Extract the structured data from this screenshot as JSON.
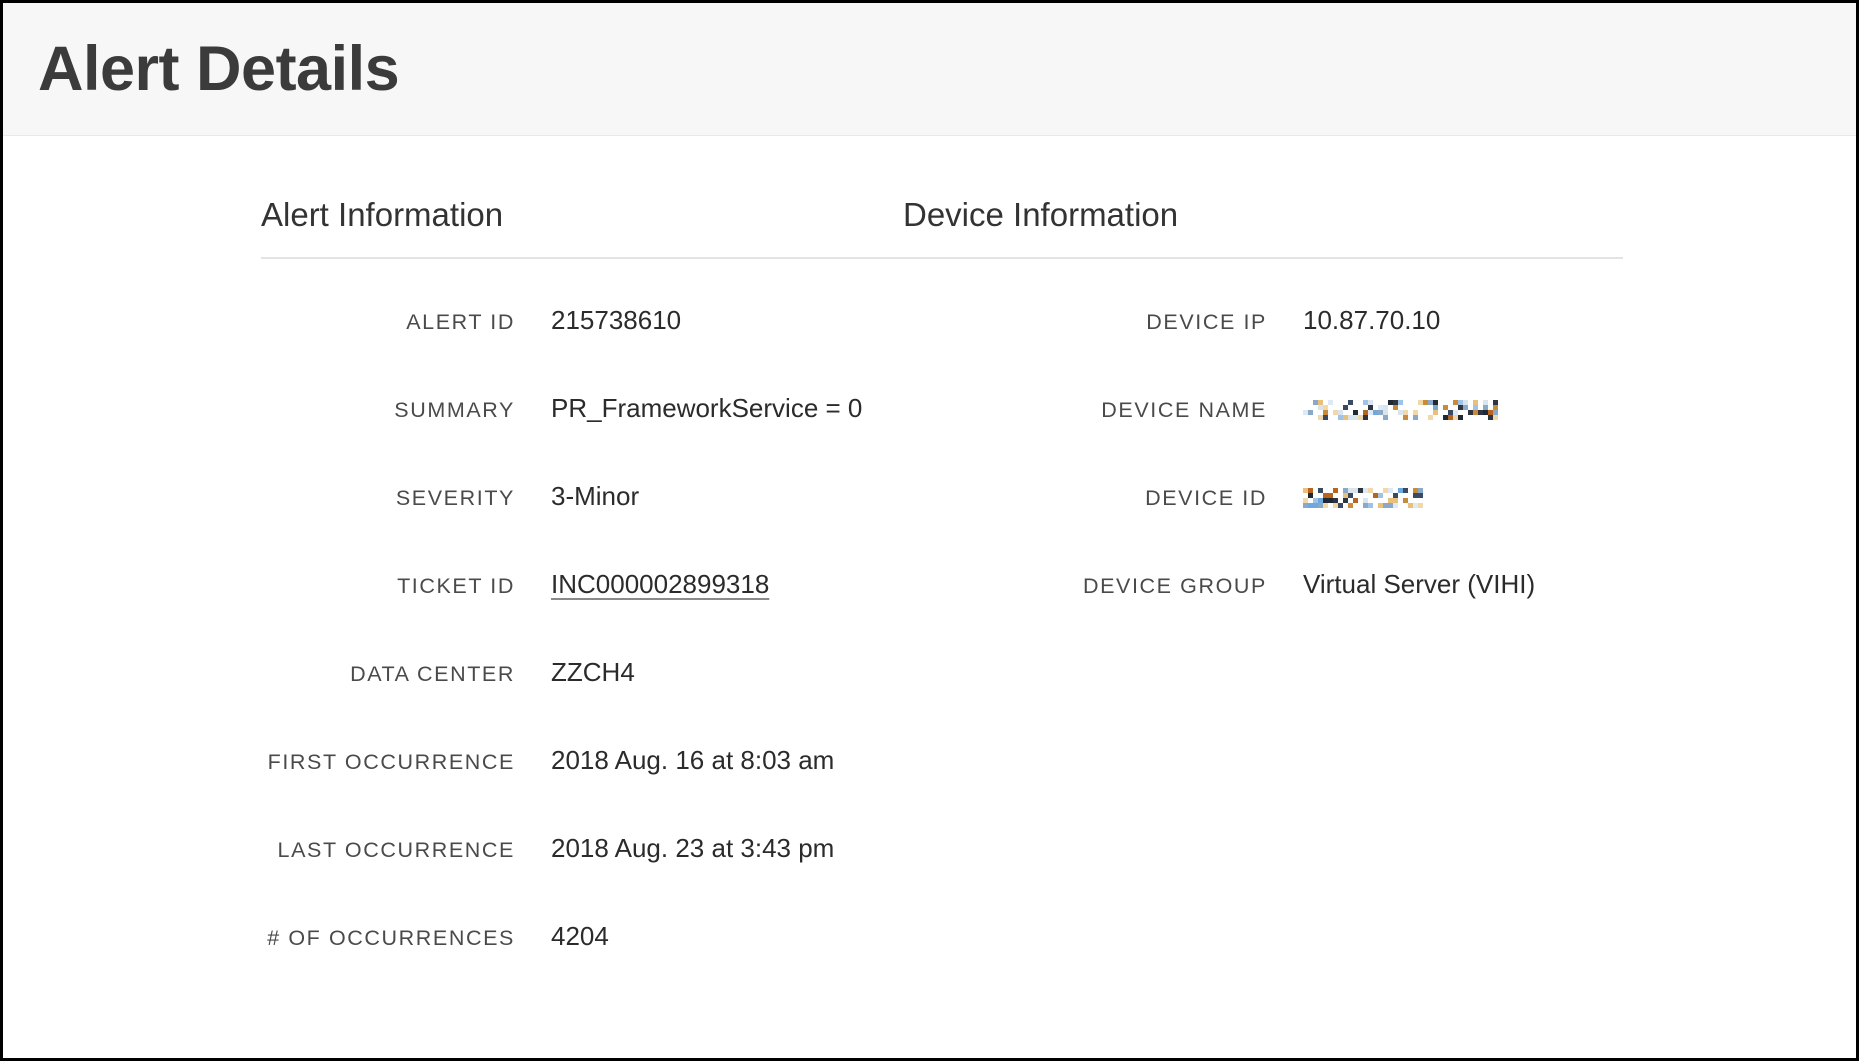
{
  "header": {
    "title": "Alert Details",
    "background_color": "#f7f7f7",
    "title_color": "#3b3b3b"
  },
  "alert_information": {
    "heading": "Alert Information",
    "fields": [
      {
        "label": "ALERT ID",
        "value": "215738610",
        "type": "text"
      },
      {
        "label": "SUMMARY",
        "value": "PR_FrameworkService = 0",
        "type": "text"
      },
      {
        "label": "SEVERITY",
        "value": "3-Minor",
        "type": "text"
      },
      {
        "label": "TICKET ID",
        "value": "INC000002899318",
        "type": "link"
      },
      {
        "label": "DATA CENTER",
        "value": "ZZCH4",
        "type": "text"
      },
      {
        "label": "FIRST OCCURRENCE",
        "value": "2018 Aug. 16 at 8:03 am",
        "type": "text"
      },
      {
        "label": "LAST OCCURRENCE",
        "value": "2018 Aug. 23 at 3:43 pm",
        "type": "text"
      },
      {
        "label": "# OF OCCURRENCES",
        "value": "4204",
        "type": "text"
      }
    ]
  },
  "device_information": {
    "heading": "Device Information",
    "fields": [
      {
        "label": "DEVICE IP",
        "value": "10.87.70.10",
        "type": "text"
      },
      {
        "label": "DEVICE NAME",
        "value": "",
        "type": "redacted",
        "redacted_width": 195
      },
      {
        "label": "DEVICE ID",
        "value": "",
        "type": "redacted",
        "redacted_width": 122
      },
      {
        "label": "DEVICE GROUP",
        "value": "Virtual Server (VIHI)",
        "type": "text"
      }
    ]
  },
  "colors": {
    "page_background": "#ffffff",
    "header_band": "#f7f7f7",
    "divider": "#e3e3e3",
    "label_text": "#4a4a4a",
    "value_text": "#2b2b2b",
    "border": "#000000"
  }
}
